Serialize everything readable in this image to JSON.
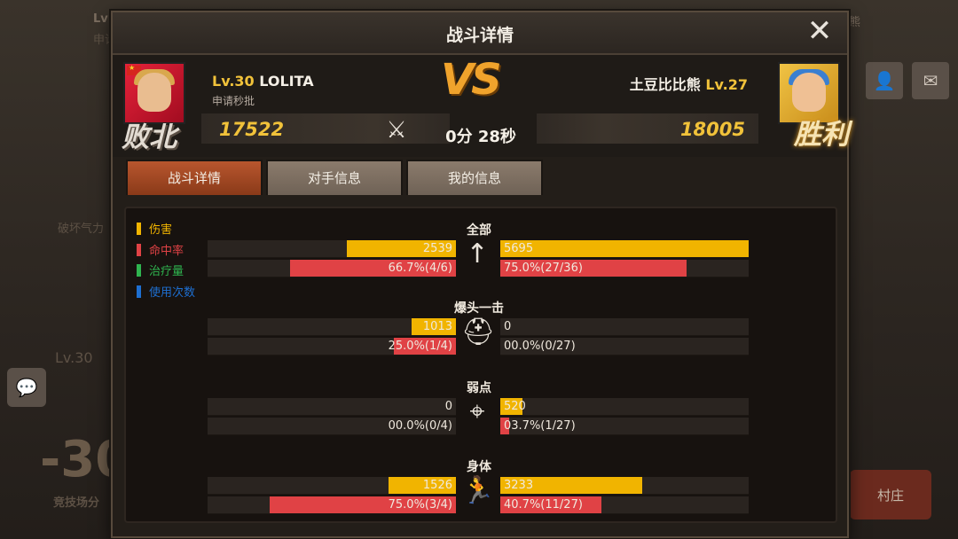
{
  "background": {
    "top_left_lv": "Lv",
    "top_left_guild": "申请",
    "top_right_name": "熊",
    "break_qi": "破坏气力",
    "lv30": "Lv.30",
    "big_num": "-30",
    "arena_points": "竞技场分",
    "village": "村庄"
  },
  "dialog": {
    "title": "战斗详情",
    "close_glyph": "✕"
  },
  "left_player": {
    "level": "Lv.30",
    "name": "LOLITA",
    "guild": "申请秒批",
    "score": "17522",
    "result": "败北"
  },
  "right_player": {
    "level": "Lv.27",
    "name": "土豆比比熊",
    "score": "18005",
    "result": "胜利"
  },
  "match": {
    "vs": "VS",
    "duration": "0分 28秒"
  },
  "tabs": [
    {
      "label": "战斗详情"
    },
    {
      "label": "对手信息"
    },
    {
      "label": "我的信息"
    }
  ],
  "legend": [
    {
      "label": "伤害",
      "color": "#f1b400"
    },
    {
      "label": "命中率",
      "color": "#e04245"
    },
    {
      "label": "治疗量",
      "color": "#2fb44f"
    },
    {
      "label": "使用次数",
      "color": "#1e6fd1"
    }
  ],
  "sections": [
    {
      "label": "全部",
      "icon": "arrow-icon",
      "left_damage": "2539",
      "left_damage_frac": 0.44,
      "right_damage": "5695",
      "right_damage_frac": 1.0,
      "left_hit": "66.7%(4/6)",
      "left_hit_frac": 0.667,
      "right_hit": "75.0%(27/36)",
      "right_hit_frac": 0.75
    },
    {
      "label": "爆头一击",
      "icon": "helmet-icon",
      "left_damage": "1013",
      "left_damage_frac": 0.18,
      "right_damage": "0",
      "right_damage_frac": 0,
      "left_hit": "25.0%(1/4)",
      "left_hit_frac": 0.25,
      "right_hit": "00.0%(0/27)",
      "right_hit_frac": 0
    },
    {
      "label": "弱点",
      "icon": "crosshair-icon",
      "left_damage": "0",
      "left_damage_frac": 0,
      "right_damage": "520",
      "right_damage_frac": 0.09,
      "left_hit": "00.0%(0/4)",
      "left_hit_frac": 0,
      "right_hit": "03.7%(1/27)",
      "right_hit_frac": 0.037
    },
    {
      "label": "身体",
      "icon": "body-icon",
      "left_damage": "1526",
      "left_damage_frac": 0.27,
      "right_damage": "3233",
      "right_damage_frac": 0.57,
      "left_hit": "75.0%(3/4)",
      "left_hit_frac": 0.75,
      "right_hit": "40.7%(11/27)",
      "right_hit_frac": 0.407
    }
  ]
}
